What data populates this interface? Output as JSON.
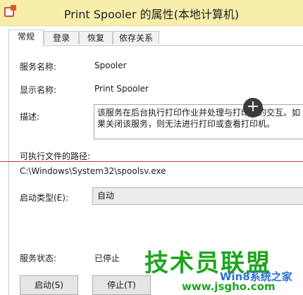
{
  "window": {
    "title": "Print Spooler 的属性(本地计算机)"
  },
  "tabs": [
    {
      "label": "常规"
    },
    {
      "label": "登录"
    },
    {
      "label": "恢复"
    },
    {
      "label": "依存关系"
    }
  ],
  "general": {
    "service_name_label": "服务名称:",
    "service_name_value": "Spooler",
    "display_name_label": "显示名称:",
    "display_name_value": "Print Spooler",
    "description_label": "描述:",
    "description_text": "该服务在后台执行打印作业并处理与打印机的交互。如果关闭该服务，则无法进行打印或查看打印机。",
    "exe_path_label": "可执行文件的路径:",
    "exe_path_value": "C:\\Windows\\System32\\spoolsv.exe",
    "startup_type_label": "启动类型(E):",
    "startup_type_value": "自动",
    "service_status_label": "服务状态:",
    "service_status_value": "已停止"
  },
  "buttons": {
    "start": "启动(S)",
    "stop": "停止(T)"
  },
  "watermark": {
    "brand": "技术员联盟",
    "sub": "Win8系统之家",
    "url": "www.jsgho.com"
  },
  "colors": {
    "titlebar": "#f8eeac",
    "watermark_green": "#1ea51e",
    "watermark_blue": "#2a6fd6",
    "annotation_line": "#d23a3a"
  }
}
